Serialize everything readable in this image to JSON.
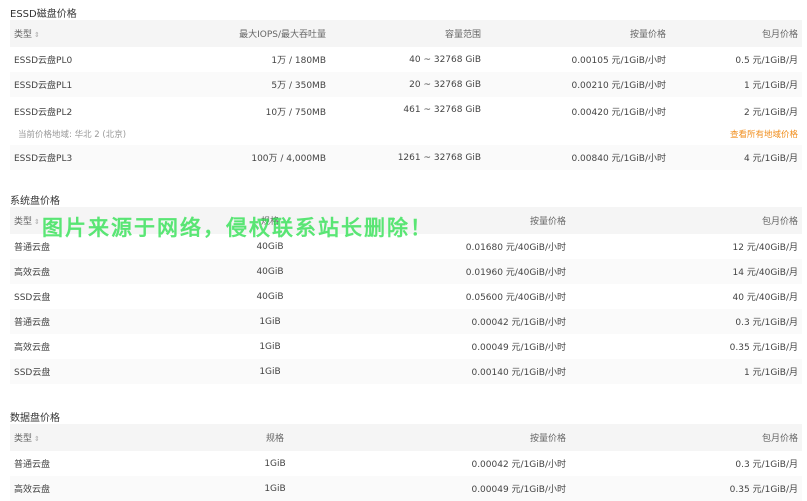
{
  "essd": {
    "title": "ESSD磁盘价格",
    "headers": {
      "type": "类型",
      "iops": "最大IOPS/最大吞吐量",
      "capacity": "容量范围",
      "hourly": "按量价格",
      "monthly": "包月价格"
    },
    "rows": [
      {
        "type": "ESSD云盘PL0",
        "iops": "1万 / 180MB",
        "capacity": "40 ~ 32768 GiB",
        "hourly": "0.00105 元/1GiB/小时",
        "monthly": "0.5 元/1GiB/月"
      },
      {
        "type": "ESSD云盘PL1",
        "iops": "5万 / 350MB",
        "capacity": "20 ~ 32768 GiB",
        "hourly": "0.00210 元/1GiB/小时",
        "monthly": "1 元/1GiB/月"
      },
      {
        "type": "ESSD云盘PL2",
        "iops": "10万 / 750MB",
        "capacity": "461 ~ 32768 GiB",
        "hourly": "0.00420 元/1GiB/小时",
        "monthly": "2 元/1GiB/月"
      },
      {
        "type": "ESSD云盘PL3",
        "iops": "100万 / 4,000MB",
        "capacity": "1261 ~ 32768 GiB",
        "hourly": "0.00840 元/1GiB/小时",
        "monthly": "4 元/1GiB/月"
      }
    ],
    "region_note": "当前价格地域: 华北 2 (北京)",
    "region_link": "查看所有地域价格"
  },
  "system": {
    "title": "系统盘价格",
    "headers": {
      "type": "类型",
      "spec": "规格",
      "hourly": "按量价格",
      "monthly": "包月价格"
    },
    "rows": [
      {
        "type": "普通云盘",
        "spec": "40GiB",
        "hourly": "0.01680 元/40GiB/小时",
        "monthly": "12 元/40GiB/月"
      },
      {
        "type": "高效云盘",
        "spec": "40GiB",
        "hourly": "0.01960 元/40GiB/小时",
        "monthly": "14 元/40GiB/月"
      },
      {
        "type": "SSD云盘",
        "spec": "40GiB",
        "hourly": "0.05600 元/40GiB/小时",
        "monthly": "40 元/40GiB/月"
      },
      {
        "type": "普通云盘",
        "spec": "1GiB",
        "hourly": "0.00042 元/1GiB/小时",
        "monthly": "0.3 元/1GiB/月"
      },
      {
        "type": "高效云盘",
        "spec": "1GiB",
        "hourly": "0.00049 元/1GiB/小时",
        "monthly": "0.35 元/1GiB/月"
      },
      {
        "type": "SSD云盘",
        "spec": "1GiB",
        "hourly": "0.00140 元/1GiB/小时",
        "monthly": "1 元/1GiB/月"
      }
    ]
  },
  "data_disk": {
    "title": "数据盘价格",
    "headers": {
      "type": "类型",
      "spec": "规格",
      "hourly": "按量价格",
      "monthly": "包月价格"
    },
    "rows": [
      {
        "type": "普通云盘",
        "spec": "1GiB",
        "hourly": "0.00042 元/1GiB/小时",
        "monthly": "0.3 元/1GiB/月"
      },
      {
        "type": "高效云盘",
        "spec": "1GiB",
        "hourly": "0.00049 元/1GiB/小时",
        "monthly": "0.35 元/1GiB/月"
      }
    ]
  },
  "sort_icon": "sort-updown-icon",
  "watermark": "图片来源于网络，侵权联系站长删除！",
  "colors": {
    "header_bg": "#f5f5f5",
    "link": "#f08d1b",
    "watermark": "#26e04a"
  }
}
